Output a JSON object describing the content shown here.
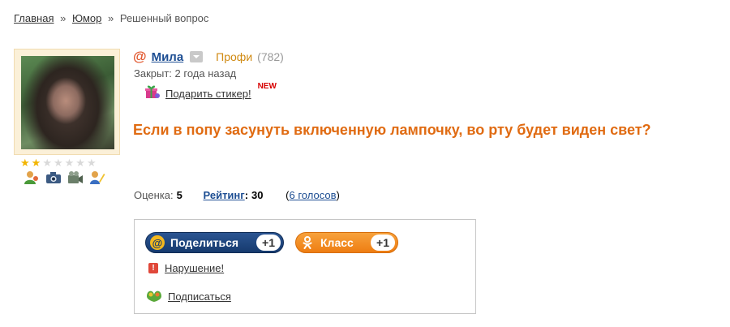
{
  "breadcrumb": {
    "home": "Главная",
    "sep1": "»",
    "category": "Юмор",
    "sep2": "»",
    "current": "Решенный вопрос"
  },
  "user": {
    "name": "Мила",
    "rank": "Профи",
    "points": "(782)",
    "closed_label": "Закрыт:",
    "closed_value": "2 года назад",
    "sticker_link": "Подарить стикер!",
    "new_badge": "NEW",
    "stars": {
      "filled": 2,
      "total": 7
    }
  },
  "question": {
    "title": "Если в попу засунуть включенную лампочку, во рту будет виден свет?"
  },
  "stats": {
    "score_label": "Оценка:",
    "score_value": "5",
    "rating_label": "Рейтинг",
    "rating_colon": ":",
    "rating_value": "30",
    "votes_open": "(",
    "votes_link": "6 голосов",
    "votes_close": ")"
  },
  "share": {
    "share_label": "Поделиться",
    "share_count": "+1",
    "class_label": "Класс",
    "class_count": "+1",
    "abuse_link": "Нарушение!",
    "subscribe_link": "Подписаться"
  },
  "colors": {
    "accent_orange": "#e06b12",
    "link_blue": "#1c4d92",
    "share_blue": "#163a6e",
    "class_orange": "#ee7d12"
  },
  "icons": [
    "at-icon",
    "mail-dropdown-icon",
    "gift-icon",
    "user-icon",
    "camera-icon",
    "video-icon",
    "edit-icon",
    "warning-icon",
    "subscribe-icon"
  ]
}
